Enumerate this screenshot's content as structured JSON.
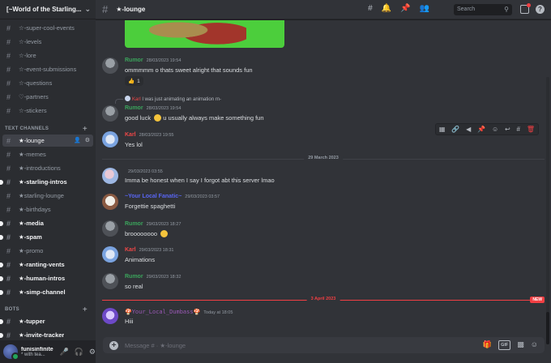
{
  "server": {
    "name": "[~World of the Starling..."
  },
  "channels_top": [
    {
      "label": "☆-super-cool-events",
      "bold": false
    },
    {
      "label": "☆-levels",
      "bold": false
    },
    {
      "label": "☆-lore",
      "bold": false
    },
    {
      "label": "☆-event-submissions",
      "bold": false
    },
    {
      "label": "☆-questions",
      "bold": false
    },
    {
      "label": "♡-partners",
      "bold": false
    },
    {
      "label": "☆-stickers",
      "bold": false
    }
  ],
  "category_text": "TEXT CHANNELS",
  "channels_text": [
    {
      "label": "★-lounge",
      "bold": true,
      "active": true
    },
    {
      "label": "★-memes",
      "bold": false
    },
    {
      "label": "★-introductions",
      "bold": false
    },
    {
      "label": "★-starling-intros",
      "bold": true
    },
    {
      "label": "★starling-lounge",
      "bold": false
    },
    {
      "label": "★-birthdays",
      "bold": false
    },
    {
      "label": "★-media",
      "bold": true
    },
    {
      "label": "★-spam",
      "bold": true
    },
    {
      "label": "★-promo",
      "bold": false
    },
    {
      "label": "★-ranting-vents",
      "bold": true
    },
    {
      "label": "★-human-intros",
      "bold": true
    },
    {
      "label": "★-simp-channel",
      "bold": true
    }
  ],
  "category_bots": "BOTS",
  "channels_bots": [
    {
      "label": "★-tupper",
      "bold": true
    },
    {
      "label": "★-invite-tracker",
      "bold": true
    }
  ],
  "user": {
    "name": "funisinfinite",
    "status": "* with tea..."
  },
  "topbar": {
    "channel": "★-lounge",
    "search_placeholder": "Search"
  },
  "colors": {
    "rumor": "#3ba55c",
    "karl": "#f04747",
    "fan": "#5865f2",
    "dumb": "#9b59b6",
    "accent": "#f23f43"
  },
  "messages": {
    "m1": {
      "author": "Rumor",
      "time": "28/03/2023 19:54",
      "text": "ommmmm o thats sweet alright that sounds fun",
      "reaction": "1"
    },
    "m2": {
      "reply_author": "Karl",
      "reply_text": "I was just animating an animation rn-",
      "author": "Rumor",
      "time": "28/03/2023 19:54",
      "text_a": "good luck",
      "text_b": "u usually always make something fun"
    },
    "m3": {
      "author": "Karl",
      "time": "28/03/2023 19:55",
      "text": "Yes lol"
    },
    "divider1": "29 March 2023",
    "m4": {
      "author": "",
      "time": "29/03/2023 03:55",
      "text": "Imma be honest when I say I forgot abt this server lmao"
    },
    "m5": {
      "author": "~Your Local Fanatic~",
      "time": "29/03/2023 03:57",
      "text": "Forgettie spaghetti"
    },
    "m6": {
      "author": "Rumor",
      "time": "29/03/2023 18:27",
      "text": "broooooooo"
    },
    "m7": {
      "author": "Karl",
      "time": "29/03/2023 18:31",
      "text": "Animations"
    },
    "m8": {
      "author": "Rumor",
      "time": "29/03/2023 18:32",
      "text": "so real"
    },
    "divider2": "3 April 2023",
    "new_badge": "NEW",
    "m9": {
      "author": "Your_Local_Dumbass",
      "time": "Today at 18:05",
      "text": "Hiii"
    }
  },
  "composer": {
    "placeholder": "Message # · ★-lounge"
  }
}
